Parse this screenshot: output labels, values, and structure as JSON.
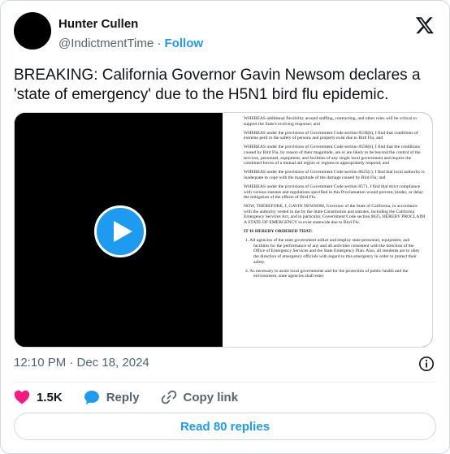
{
  "author": {
    "name": "Hunter Cullen",
    "handle": "@IndictmentTime",
    "separator": "·",
    "follow_label": "Follow"
  },
  "tweet": {
    "text": "BREAKING: California Governor Gavin Newsom declares a 'state of emergency' due to the H5N1 bird flu epidemic.",
    "timestamp": "12:10 PM · Dec 18, 2024"
  },
  "document": {
    "paragraphs": [
      "WHEREAS additional flexibility around staffing, contracting, and other rules will be critical to support the State's evolving response; and",
      "WHEREAS under the provisions of Government Code section 8558(b), I find that conditions of extreme peril to the safety of persons and property exist due to Bird Flu; and",
      "WHEREAS under the provisions of Government Code section 8558(b), I find that the conditions caused by Bird Flu, by reason of their magnitude, are or are likely to be beyond the control of the services, personnel, equipment, and facilities of any single local government and require the combined forces of a mutual aid region or regions to appropriately respond; and",
      "WHEREAS under the provisions of Government Code section 8625(c), I find that local authority is inadequate to cope with the magnitude of the damage caused by Bird Flu; and",
      "WHEREAS under the provisions of Government Code section 8571, I find that strict compliance with various statutes and regulations specified in this Proclamation would prevent, hinder, or delay the mitigation of the effects of Bird Flu.",
      "NOW, THEREFORE, I, GAVIN NEWSOM, Governor of the State of California, in accordance with the authority vested in me by the State Constitution and statutes, including the California Emergency Services Act, and in particular, Government Code section 8625, HEREBY PROCLAIM A STATE OF EMERGENCY to exist statewide due to Bird Flu."
    ],
    "ordered_heading": "IT IS HEREBY ORDERED THAT:",
    "items": [
      "1.  All agencies of the state government utilize and employ state personnel, equipment, and facilities for the performance of any and all activities consistent with the direction of the Office of Emergency Services and the State Emergency Plan. Also, all residents are to obey the direction of emergency officials with regard to this emergency in order to protect their safety.",
      "2.  As necessary to assist local governments and for the protection of public health and the environment, state agencies shall enter"
    ]
  },
  "actions": {
    "likes": "1.5K",
    "reply_label": "Reply",
    "copy_link_label": "Copy link",
    "read_replies_label": "Read 80 replies"
  },
  "colors": {
    "accent": "#1d9bf0",
    "like": "#f91880",
    "muted": "#536471"
  },
  "icons": [
    "x-logo-icon",
    "play-icon",
    "info-icon",
    "heart-icon",
    "reply-bubble-icon",
    "link-icon"
  ]
}
